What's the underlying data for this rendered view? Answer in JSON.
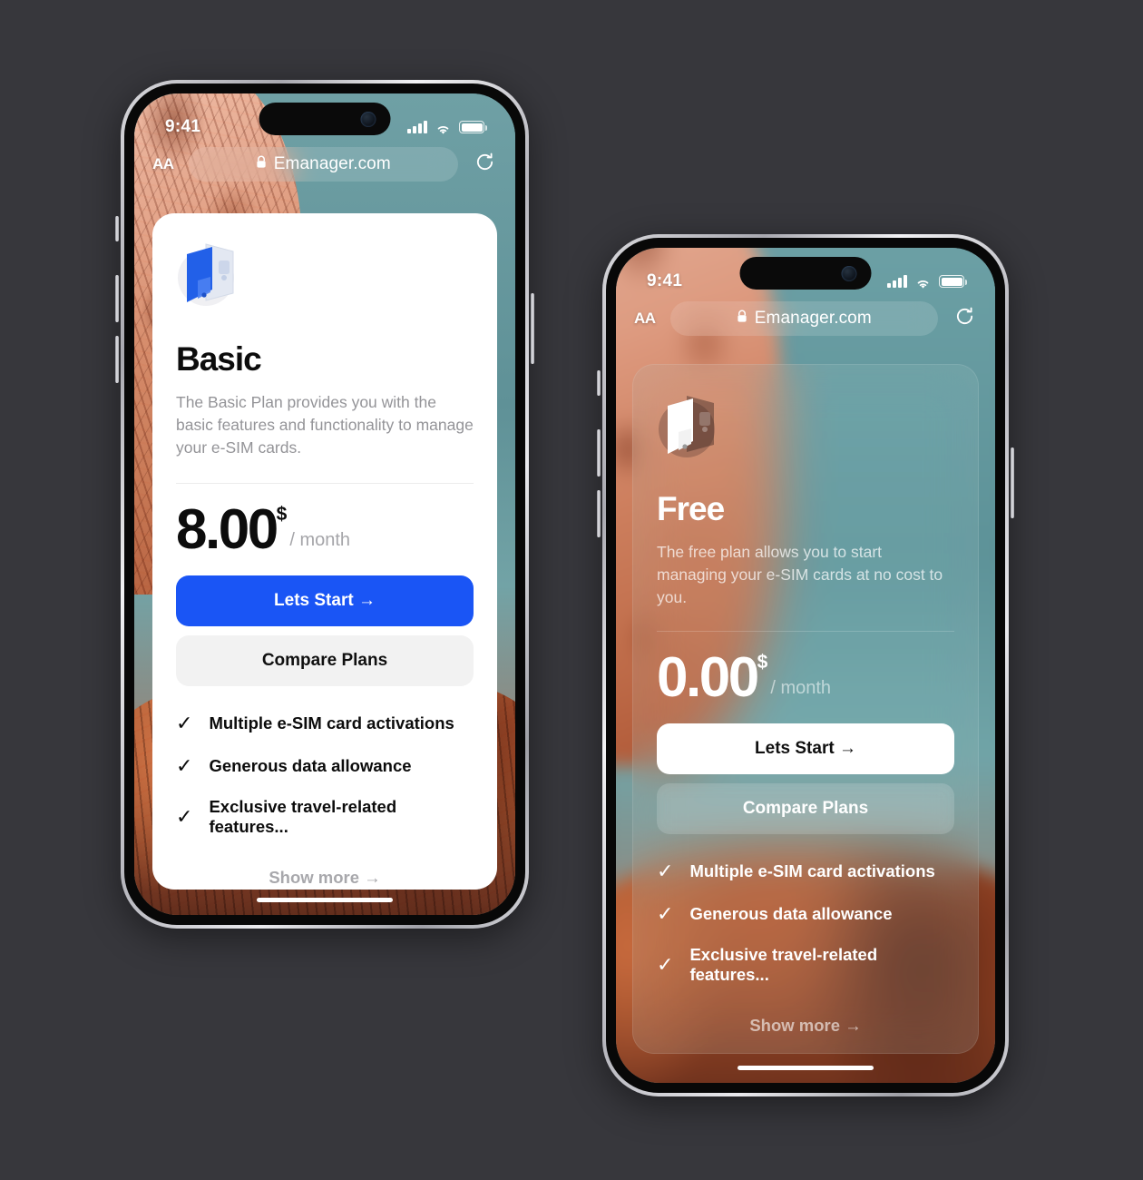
{
  "background_color": "#37373c",
  "accent_blue": "#1a55f5",
  "phones": [
    {
      "id": "phone-basic",
      "style": "light",
      "status": {
        "time": "9:41",
        "signal_icon": "cellular-signal-icon",
        "wifi_icon": "wifi-icon",
        "battery_icon": "battery-full-icon"
      },
      "browser": {
        "text_size_label": "AA",
        "lock_icon": "lock-icon",
        "url": "Emanager.com",
        "reload_icon": "reload-icon"
      },
      "card": {
        "logo_icon": "esim-card-stack-icon",
        "title": "Basic",
        "description": "The Basic Plan provides you with the basic features and functionality to manage your e-SIM cards.",
        "price": "8.00",
        "currency": "$",
        "period": "/ month",
        "primary_button": "Lets Start →",
        "secondary_button": "Compare Plans",
        "features": [
          "Multiple e-SIM card activations",
          "Generous data allowance",
          "Exclusive travel-related features..."
        ],
        "check_icon": "check-icon",
        "show_more": "Show more →"
      }
    },
    {
      "id": "phone-free",
      "style": "glass",
      "status": {
        "time": "9:41",
        "signal_icon": "cellular-signal-icon",
        "wifi_icon": "wifi-icon",
        "battery_icon": "battery-full-icon"
      },
      "browser": {
        "text_size_label": "AA",
        "lock_icon": "lock-icon",
        "url": "Emanager.com",
        "reload_icon": "reload-icon"
      },
      "card": {
        "logo_icon": "esim-card-stack-icon",
        "title": "Free",
        "description": "The free plan allows you to start managing your e-SIM cards at no cost to you.",
        "price": "0.00",
        "currency": "$",
        "period": "/ month",
        "primary_button": "Lets Start →",
        "secondary_button": "Compare Plans",
        "features": [
          "Multiple e-SIM card activations",
          "Generous data allowance",
          "Exclusive travel-related features..."
        ],
        "check_icon": "check-icon",
        "show_more": "Show more →"
      }
    }
  ]
}
